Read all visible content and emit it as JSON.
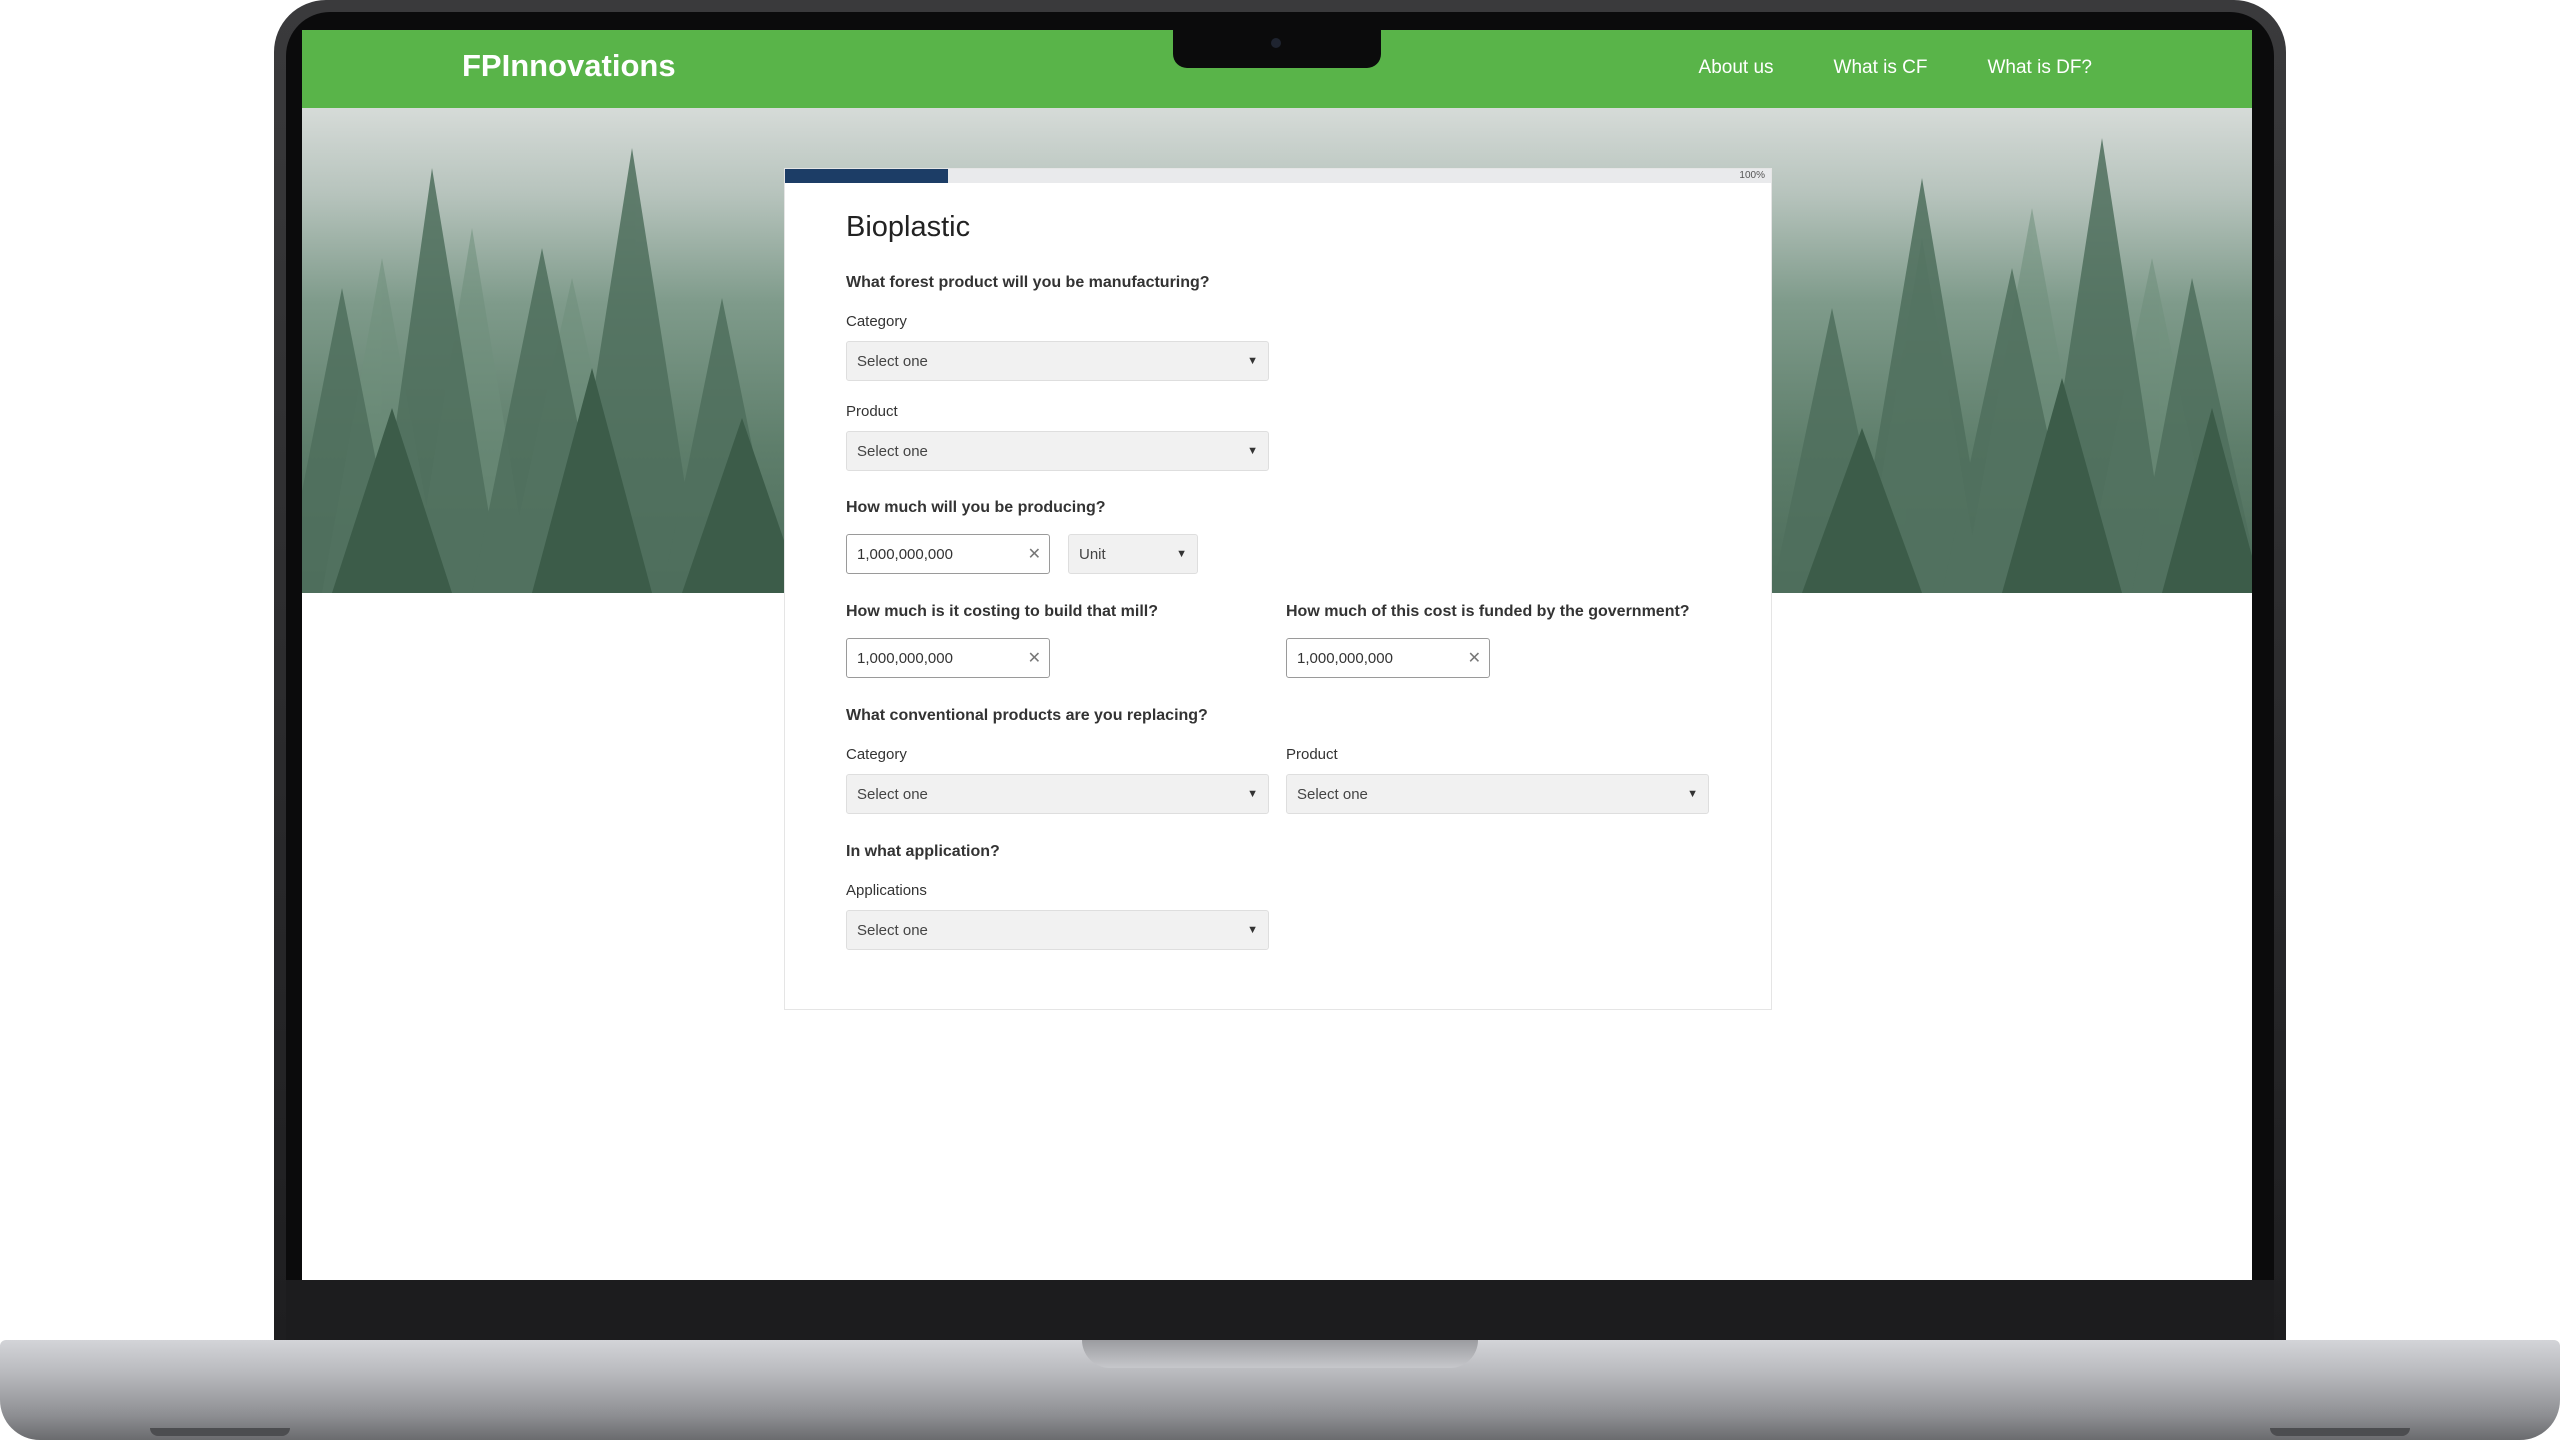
{
  "header": {
    "brand": "FPInnovations",
    "nav": [
      "About us",
      "What is CF",
      "What is DF?"
    ]
  },
  "progress": {
    "value_percent": 16.5,
    "label": "100%"
  },
  "form": {
    "title": "Bioplastic",
    "q_manufacture": "What forest product will you be manufacturing?",
    "category_label": "Category",
    "category_value": "Select one",
    "product_label": "Product",
    "product_value": "Select one",
    "q_quantity": "How much will you be producing?",
    "quantity_value": "1,000,000,000",
    "unit_value": "Unit",
    "q_cost": "How much  is it costing to build that mill?",
    "cost_value": "1,000,000,000",
    "q_funded": "How much of this cost is funded by the government?",
    "funded_value": "1,000,000,000",
    "q_replacing": "What conventional products are you replacing?",
    "replace_category_label": "Category",
    "replace_category_value": "Select one",
    "replace_product_label": "Product",
    "replace_product_value": "Select one",
    "q_application": "In what application?",
    "applications_label": "Applications",
    "applications_value": "Select one"
  },
  "icons": {
    "caret": "caret-down-icon",
    "clear": "clear-x-icon"
  },
  "colors": {
    "header": "#59b449",
    "progress": "#1c3d66"
  }
}
